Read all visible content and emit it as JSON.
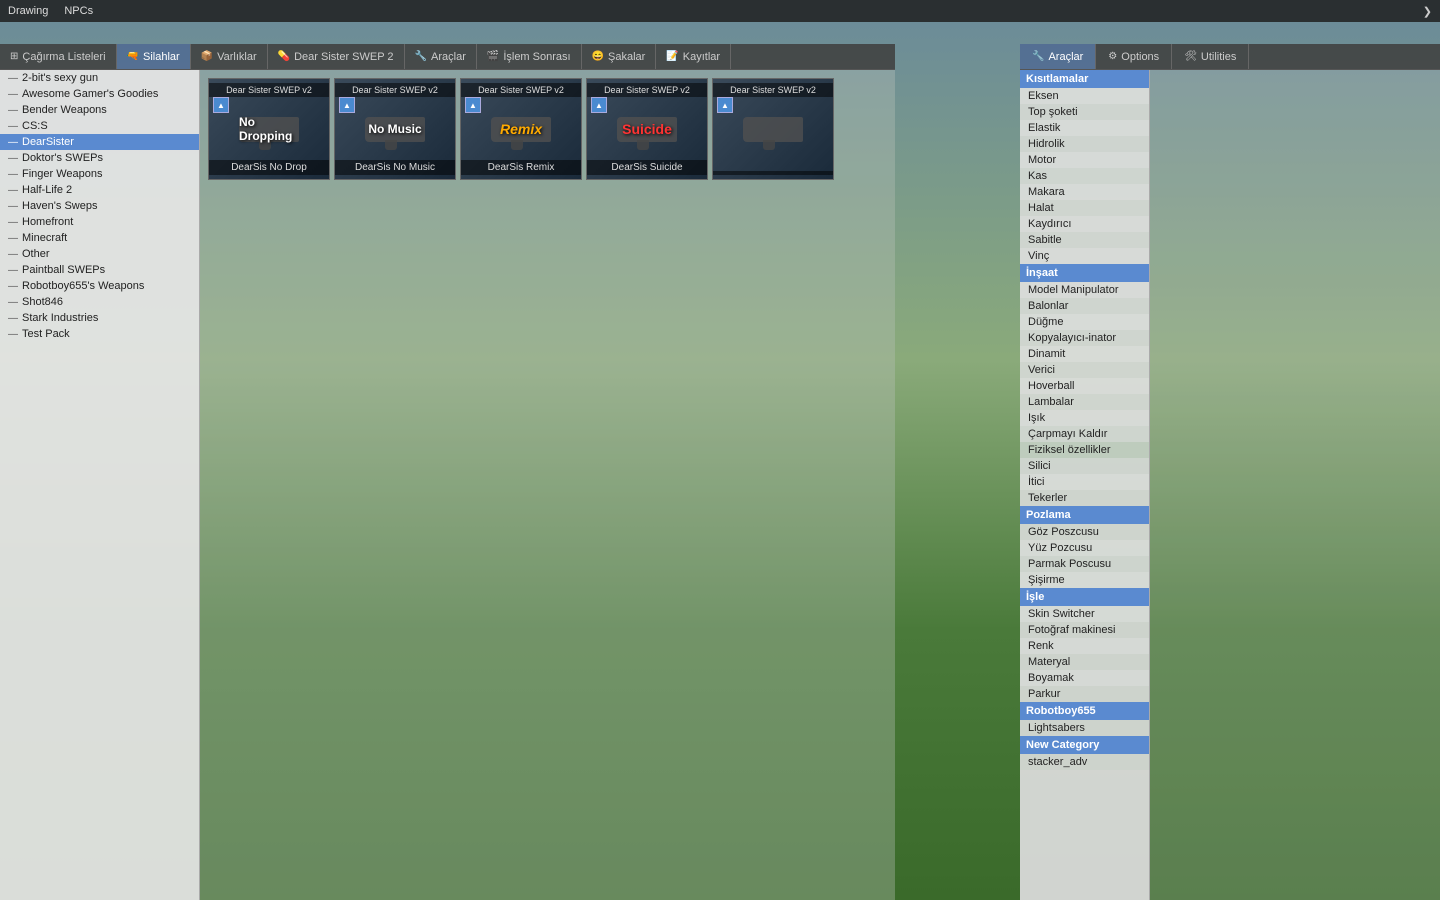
{
  "topbar": {
    "items": [
      "Drawing",
      "NPCs"
    ]
  },
  "tabs": [
    {
      "label": "Çağırma Listeleri",
      "icon": "⊞",
      "active": false
    },
    {
      "label": "Silahlar",
      "icon": "🔫",
      "active": true
    },
    {
      "label": "Varlıklar",
      "icon": "📦",
      "active": false
    },
    {
      "label": "Dear Sister SWEP 2",
      "icon": "💊",
      "active": false
    },
    {
      "label": "Araçlar",
      "icon": "🔧",
      "active": false
    },
    {
      "label": "İşlem Sonrası",
      "icon": "🎬",
      "active": false
    },
    {
      "label": "Şakalar",
      "icon": "😄",
      "active": false
    },
    {
      "label": "Kayıtlar",
      "icon": "📝",
      "active": false
    }
  ],
  "sidebar": {
    "items": [
      {
        "label": "2-bit's sexy gun"
      },
      {
        "label": "Awesome Gamer's Goodies"
      },
      {
        "label": "Bender Weapons"
      },
      {
        "label": "CS:S"
      },
      {
        "label": "DearSister",
        "active": true
      },
      {
        "label": "Doktor's SWEPs"
      },
      {
        "label": "Finger Weapons"
      },
      {
        "label": "Half-Life 2"
      },
      {
        "label": "Haven's Sweps"
      },
      {
        "label": "Homefront"
      },
      {
        "label": "Minecraft"
      },
      {
        "label": "Other"
      },
      {
        "label": "Paintball SWEPs"
      },
      {
        "label": "Robotboy655's Weapons"
      },
      {
        "label": "Shot846"
      },
      {
        "label": "Stark Industries"
      },
      {
        "label": "Test Pack"
      }
    ]
  },
  "weapons": [
    {
      "title": "Dear Sister SWEP v2",
      "name": "DearSis No Drop",
      "overlay": "No Dropping",
      "overlayType": "nodrop"
    },
    {
      "title": "Dear Sister SWEP v2",
      "name": "DearSis No Music",
      "overlay": "No Music",
      "overlayType": "nomusic"
    },
    {
      "title": "Dear Sister SWEP v2",
      "name": "DearSis Remix",
      "overlay": "Remix",
      "overlayType": "remix"
    },
    {
      "title": "Dear Sister SWEP v2",
      "name": "DearSis Suicide",
      "overlay": "Suicide",
      "overlayType": "suicide"
    },
    {
      "title": "Dear Sister SWEP v2",
      "name": "",
      "overlay": "",
      "overlayType": ""
    }
  ],
  "tools": {
    "tabs": [
      {
        "label": "Araçlar",
        "icon": "🔧",
        "active": true
      },
      {
        "label": "Options",
        "icon": "⚙",
        "active": false
      },
      {
        "label": "Utilities",
        "icon": "🛠",
        "active": false
      }
    ],
    "categories": [
      {
        "header": "Kısıtlamalar",
        "items": [
          "Eksen",
          "Top şoketi",
          "Elastik",
          "Hidrolik",
          "Motor",
          "Kas",
          "Makara",
          "Halat",
          "Kaydırıcı",
          "Sabitle",
          "Vinç"
        ]
      },
      {
        "header": "İnşaat",
        "items": [
          "Model Manipulator",
          "Balonlar",
          "Düğme",
          "Kopyalayıcı-inator",
          "Dinamit",
          "Verici",
          "Hoverball",
          "Lambalar",
          "Işık",
          "Çarpmayı Kaldır",
          "Fiziksel özellikler",
          "Silici",
          "İtici",
          "Tekerler"
        ]
      },
      {
        "header": "Pozlama",
        "items": [
          "Göz Poszcusu",
          "Yüz Pozcusu",
          "Parmak Poscusu",
          "Şişirme"
        ]
      },
      {
        "header": "İşle",
        "items": [
          "Skin Switcher",
          "Fotoğraf makinesi",
          "Renk",
          "Materyal",
          "Boyamak",
          "Parkur"
        ]
      },
      {
        "header": "Robotboy655",
        "items": [
          "Lightsabers"
        ]
      },
      {
        "header": "New Category",
        "items": [
          "stacker_adv"
        ]
      }
    ]
  }
}
